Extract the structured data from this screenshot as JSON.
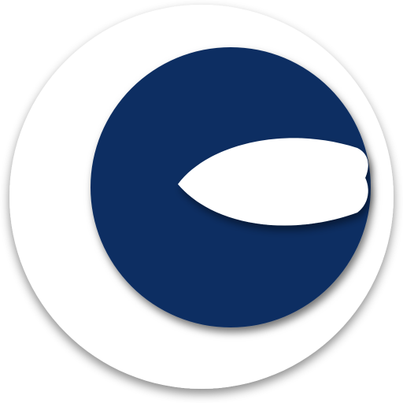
{
  "logo": {
    "icon_name": "app-logo-icon",
    "colors": {
      "background": "#ffffff",
      "badge": "#ffffff",
      "mark": "#0b2d62",
      "cutout": "#ffffff",
      "shadow": "#000000"
    }
  }
}
